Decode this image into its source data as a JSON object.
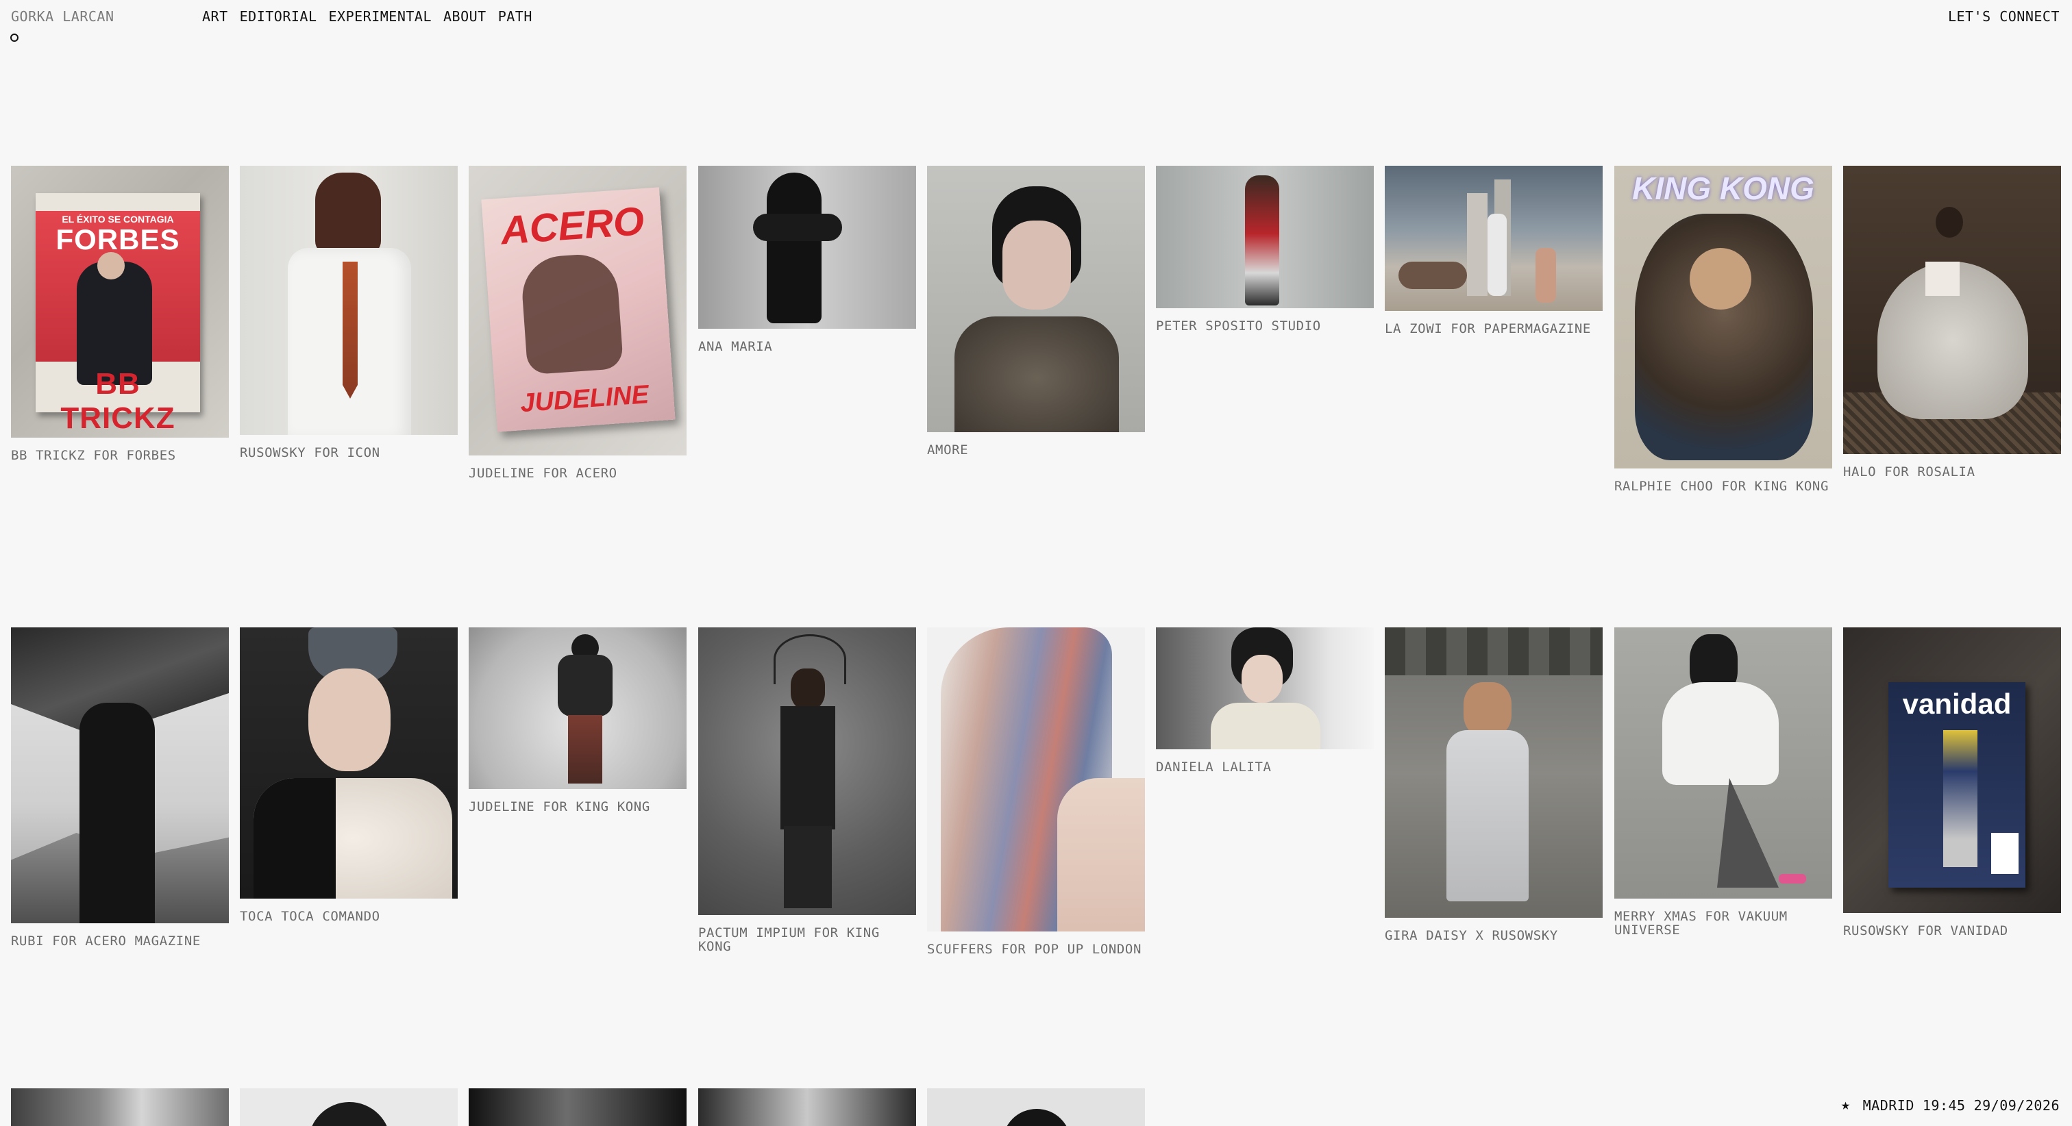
{
  "header": {
    "brand": "GORKA LARCAN",
    "nav": [
      "ART",
      "EDITORIAL",
      "EXPERIMENTAL",
      "ABOUT",
      "PATH"
    ],
    "connect": "LET'S CONNECT"
  },
  "projects": [
    {
      "caption": "BB TRICKZ FOR FORBES"
    },
    {
      "caption": "RUSOWSKY FOR ICON"
    },
    {
      "caption": "JUDELINE FOR ACERO"
    },
    {
      "caption": "ANA MARIA"
    },
    {
      "caption": "AMORE"
    },
    {
      "caption": "PETER SPOSITO STUDIO"
    },
    {
      "caption": "LA ZOWI FOR PAPERMAGAZINE"
    },
    {
      "caption": "RALPHIE CHOO FOR KING KONG"
    },
    {
      "caption": "HALO FOR ROSALIA"
    },
    {
      "caption": "RUBI FOR ACERO MAGAZINE"
    },
    {
      "caption": "TOCA TOCA COMANDO"
    },
    {
      "caption": "JUDELINE FOR KING KONG"
    },
    {
      "caption": "PACTUM IMPIUM FOR KING KONG"
    },
    {
      "caption": "SCUFFERS FOR POP UP LONDON"
    },
    {
      "caption": "DANIELA LALITA"
    },
    {
      "caption": "GIRA DAISY X RUSOWSKY"
    },
    {
      "caption": "MERRY XMAS FOR VAKUUM UNIVERSE"
    },
    {
      "caption": "RUSOWSKY FOR VANIDAD"
    }
  ],
  "covers": {
    "forbes_top": "EL ÉXITO SE CONTAGIA",
    "forbes": "FORBES",
    "forbes_bottom": "BB TRICKZ",
    "acero": "ACERO",
    "acero_bottom": "JUDELINE",
    "kingkong": "KING KONG",
    "vanidad": "vanidad"
  },
  "footer": {
    "star": "★",
    "city": "MADRID",
    "time": "19:45",
    "date": "29/09/2026"
  }
}
